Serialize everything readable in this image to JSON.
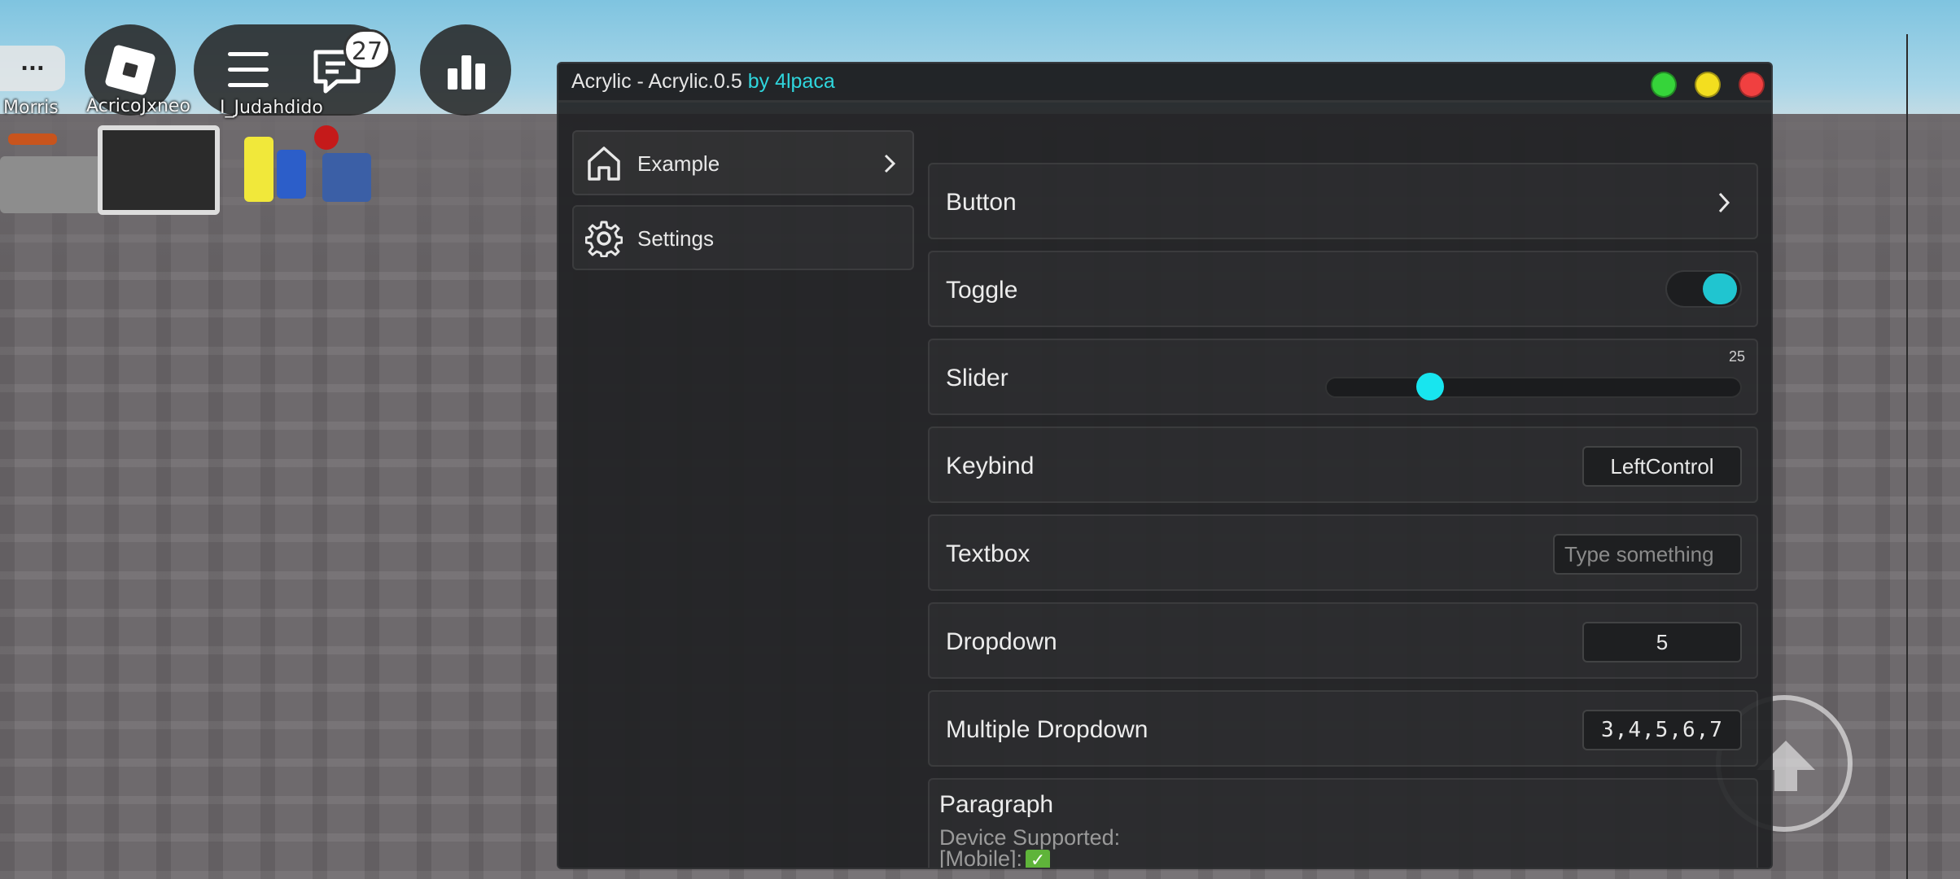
{
  "hud": {
    "more_label": "...",
    "chat_badge": "27",
    "players": [
      "Morris",
      "AcricoJxneo",
      "I_Judahdido"
    ]
  },
  "window": {
    "title": "Acrylic - Acrylic.0.5",
    "author": "by 4lpaca",
    "accent": "#2fd6dd"
  },
  "tabs": [
    {
      "label": "Example",
      "icon": "home-icon"
    },
    {
      "label": "Settings",
      "icon": "gear-icon"
    }
  ],
  "elements": {
    "button": {
      "label": "Button"
    },
    "toggle": {
      "label": "Toggle",
      "value": true
    },
    "slider": {
      "label": "Slider",
      "value": "25",
      "min": 0,
      "max": 100
    },
    "keybind": {
      "label": "Keybind",
      "value": "LeftControl"
    },
    "textbox": {
      "label": "Textbox",
      "placeholder": "Type something"
    },
    "dropdown": {
      "label": "Dropdown",
      "value": "5"
    },
    "multi_dropdown": {
      "label": "Multiple Dropdown",
      "value": "3,4,5,6,7"
    },
    "paragraph": {
      "title": "Paragraph",
      "line1": "Device Supported:",
      "line2": "[Mobile]:"
    }
  }
}
